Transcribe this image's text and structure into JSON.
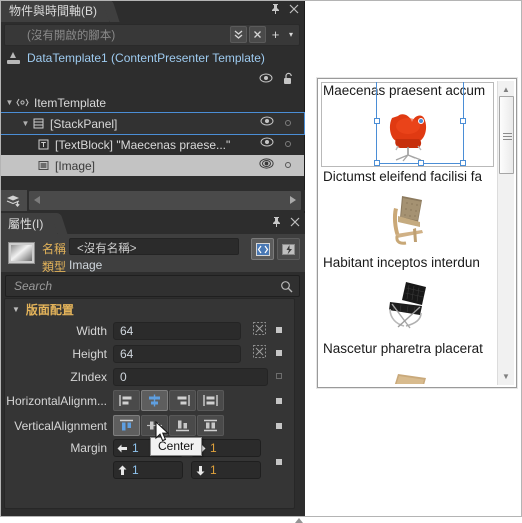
{
  "objects_panel": {
    "tab_label": "物件與時間軸(B)",
    "pin_icon": "pin-icon",
    "close_icon": "close-icon",
    "script_placeholder": "(沒有開啟的腳本)",
    "script_btn_collapse": "chevron-double-down-icon",
    "script_btn_clear": "x-circle-icon",
    "script_btn_add": "+",
    "script_btn_menu": "▾",
    "root_label": "DataTemplate1 (ContentPresenter Template)",
    "root_eye_icon": "eye-icon",
    "root_lock_icon": "lock-open-icon",
    "tree": [
      {
        "label": "ItemTemplate",
        "twisty": "▼",
        "icon": "template-icon",
        "indent": 1,
        "state": "normal",
        "has_eye": false
      },
      {
        "label": "[StackPanel]",
        "twisty": "▼",
        "icon": "stackpanel-icon",
        "indent": 2,
        "state": "selected",
        "has_eye": true
      },
      {
        "label": "[TextBlock] \"Maecenas praese...\"",
        "twisty": "",
        "icon": "textblock-icon",
        "indent": 3,
        "state": "normal",
        "has_eye": true
      },
      {
        "label": "[Image]",
        "twisty": "",
        "icon": "image-icon",
        "indent": 3,
        "state": "highlight",
        "has_eye": true
      }
    ]
  },
  "navbar": {
    "layer_icon": "layers-down-icon",
    "arrow_left": "arrow-left-icon",
    "arrow_right": "arrow-right-icon"
  },
  "properties_panel": {
    "tab_label": "屬性(I)",
    "pin_icon": "pin-icon",
    "close_icon": "close-icon",
    "name_label": "名稱",
    "name_value": "<沒有名稱>",
    "type_label": "類型",
    "type_value": "Image",
    "btn_properties_icon": "properties-icon",
    "btn_events_icon": "events-lightning-icon",
    "search_placeholder": "Search",
    "search_value": "",
    "search_icon": "search-icon",
    "section": {
      "title": "版面配置",
      "twisty": "▼",
      "rows": [
        {
          "label": "Width",
          "value": "64"
        },
        {
          "label": "Height",
          "value": "64"
        },
        {
          "label": "ZIndex",
          "value": "0"
        }
      ],
      "horizontal_alignment": {
        "label": "HorizontalAlignm...",
        "options": [
          "Left",
          "Center",
          "Right",
          "Stretch"
        ],
        "selected": "Center"
      },
      "vertical_alignment": {
        "label": "VerticalAlignment",
        "options": [
          "Top",
          "Center",
          "Bottom",
          "Stretch"
        ],
        "selected": "Top"
      },
      "margin": {
        "label": "Margin",
        "left": "1",
        "right": "1",
        "top": "1",
        "bottom": "1"
      }
    }
  },
  "tooltip": {
    "text": "Center"
  },
  "preview": {
    "items": [
      {
        "text": "Maecenas praesent accum",
        "image": "red-swan-chair"
      },
      {
        "text": "Dictumst eleifend facilisi fa",
        "image": "wood-lounge-chair"
      },
      {
        "text": "Habitant inceptos interdun",
        "image": "black-barcelona-chair"
      },
      {
        "text": "Nascetur pharetra placerat",
        "image": "tan-chaise"
      }
    ],
    "scroll_up_icon": "triangle-up-icon",
    "scroll_down_icon": "triangle-down-icon"
  },
  "colors": {
    "panel_bg": "#2d2d2d",
    "tab_bg": "#3f3f3f",
    "accent_gold": "#e3b35a",
    "accent_blue": "#9ecbf0",
    "selection_blue": "#4b8ed6",
    "field_bg": "#2b2b2b",
    "highlight_row": "#c3c3c3"
  }
}
